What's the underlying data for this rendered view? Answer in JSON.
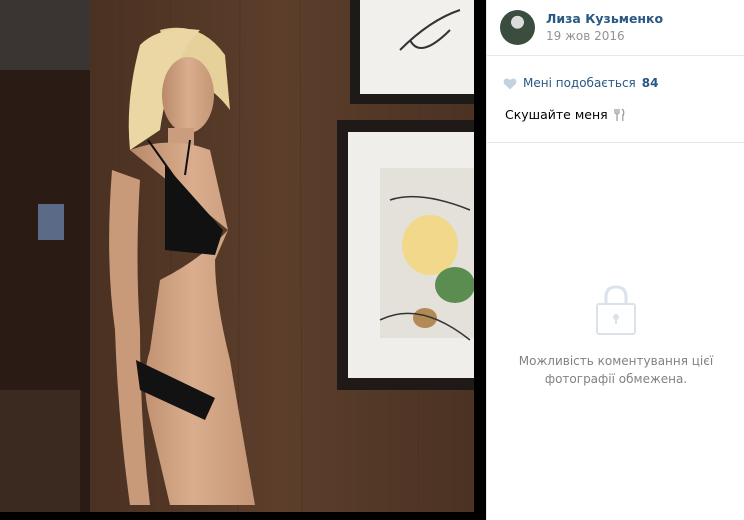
{
  "author": {
    "name": "Лиза Кузьменко",
    "date": "19 жов 2016"
  },
  "likes": {
    "label": "Мені подобається",
    "count": "84"
  },
  "caption": {
    "text": "Скушайте меня"
  },
  "comments": {
    "restricted_text": "Можливість коментування цієї фотографії обмежена."
  },
  "colors": {
    "link": "#2a5885",
    "muted": "#939393",
    "divider": "#e7e8ec"
  },
  "icons": {
    "like": "heart-icon",
    "caption_emoji": "fork-and-knife-icon",
    "restricted": "lock-icon"
  }
}
